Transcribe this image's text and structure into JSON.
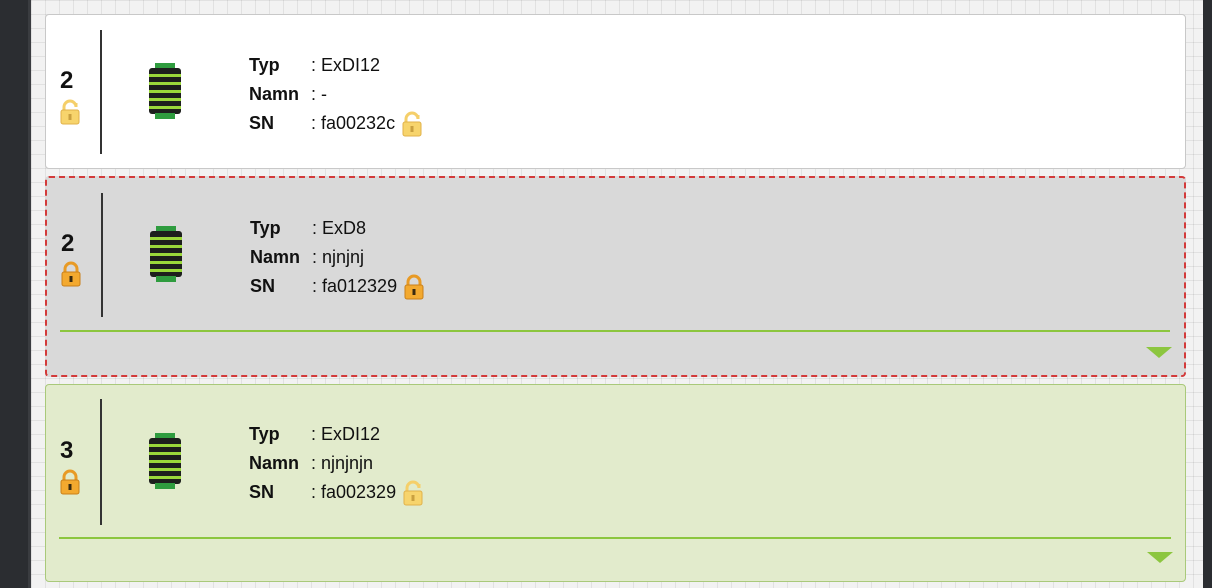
{
  "cards": [
    {
      "index": "2",
      "index_lock_icon": "unlocked-padlock-icon",
      "typ_label": "Typ",
      "typ_value": ": ExDI12",
      "namn_label": "Namn",
      "namn_value": ": -",
      "sn_label": "SN",
      "sn_value": ": fa00232c",
      "sn_lock_icon": "unlocked-padlock-icon",
      "state": "default"
    },
    {
      "index": "2",
      "index_lock_icon": "locked-padlock-icon",
      "typ_label": "Typ",
      "typ_value": ": ExD8",
      "namn_label": "Namn",
      "namn_value": ": njnjnj",
      "sn_label": "SN",
      "sn_value": ": fa012329",
      "sn_lock_icon": "locked-padlock-icon",
      "state": "selected"
    },
    {
      "index": "3",
      "index_lock_icon": "locked-padlock-icon",
      "typ_label": "Typ",
      "typ_value": ": ExDI12",
      "namn_label": "Namn",
      "namn_value": ": njnjnjn",
      "sn_label": "SN",
      "sn_value": ": fa002329",
      "sn_lock_icon": "unlocked-padlock-icon",
      "state": "active"
    }
  ],
  "colors": {
    "selected_border": "#d33a3a",
    "accent_green": "#8cc63f",
    "lock_orange": "#f0a030"
  }
}
